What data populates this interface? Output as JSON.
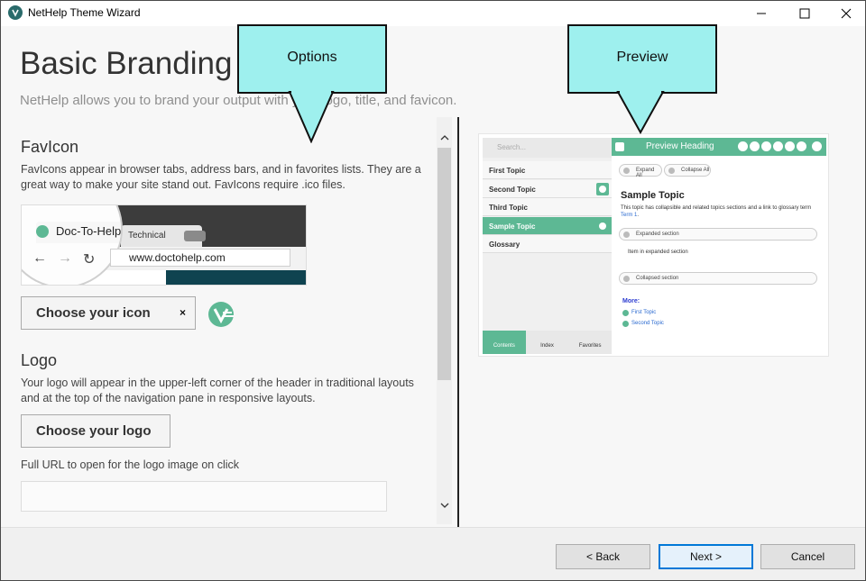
{
  "window": {
    "title": "NetHelp Theme Wizard"
  },
  "page": {
    "heading": "Basic Branding",
    "subheading": "NetHelp allows you to brand your output with your logo, title, and favicon."
  },
  "favicon": {
    "title": "FavIcon",
    "description": "FavIcons appear in browser tabs, address bars, and in favorites lists. They are a great way to make your site stand out. FavIcons require .ico files.",
    "browser_tab_label": "Doc-To-Help",
    "browser_tab2_label": "Technical",
    "browser_url": "www.doctohelp.com",
    "choose_label": "Choose your icon",
    "clear_label": "×"
  },
  "logo": {
    "title": "Logo",
    "description": "Your logo will appear in the upper-left corner of the header in traditional layouts and at the top of the navigation pane in responsive layouts.",
    "choose_label": "Choose your logo",
    "url_label": "Full URL to open for the logo image on click",
    "url_value": "",
    "url_placeholder": ""
  },
  "callouts": {
    "options": "Options",
    "preview": "Preview"
  },
  "preview": {
    "search_placeholder": "Search...",
    "heading": "Preview Heading",
    "nav_items": [
      "First Topic",
      "Second Topic",
      "Third Topic",
      "Sample Topic",
      "Glossary"
    ],
    "tabs": [
      "Contents",
      "Index",
      "Favorites"
    ],
    "expand_all": "Expand All",
    "collapse_all": "Collapse All",
    "topic_title": "Sample Topic",
    "topic_text": "This topic has collapsible and related topics sections and a link to glossary term",
    "topic_link": "Term 1",
    "expanded_section": "Expanded section",
    "expanded_body": "Item in expanded section",
    "collapsed_section": "Collapsed section",
    "more_label": "More:",
    "more_links": [
      "First Topic",
      "Second Topic"
    ],
    "accent_color": "#5db894"
  },
  "footer": {
    "back_label": "< Back",
    "next_label": "Next >",
    "cancel_label": "Cancel"
  }
}
